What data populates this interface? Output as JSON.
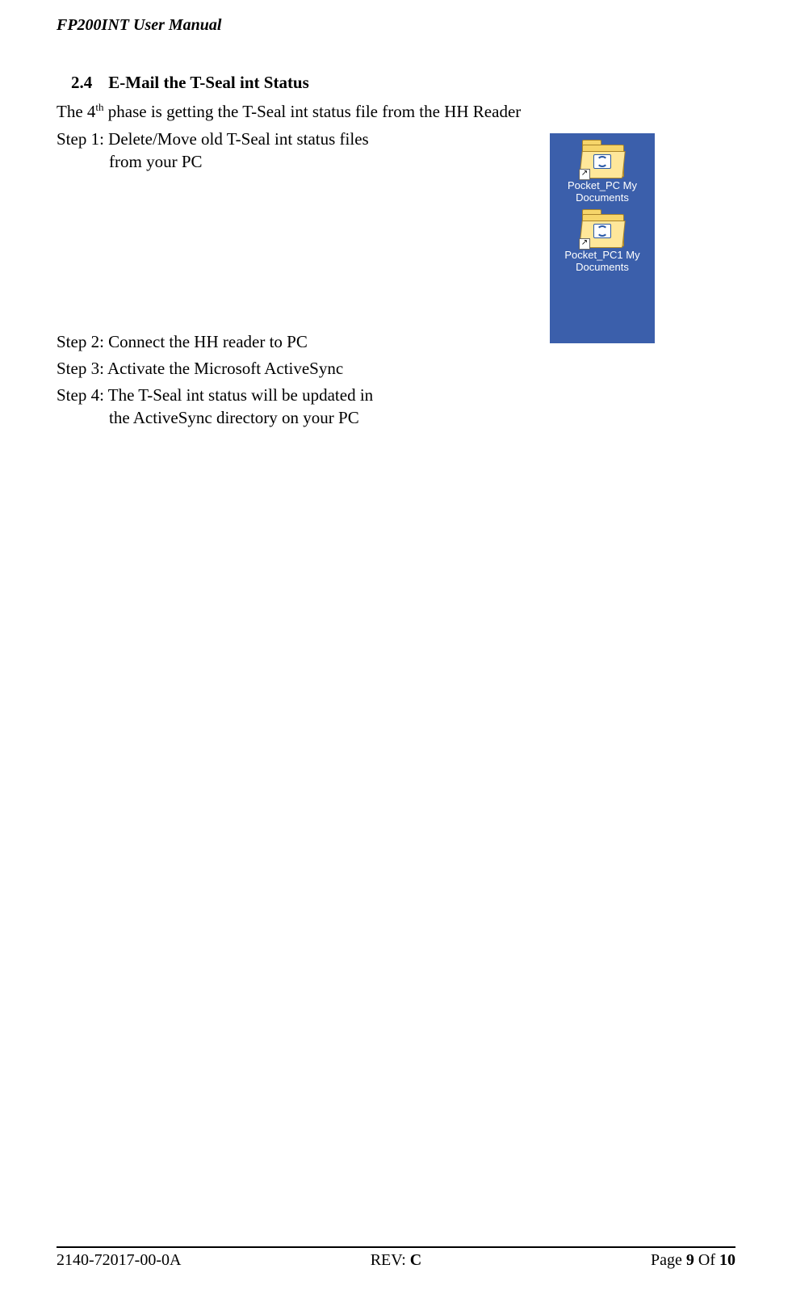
{
  "header": {
    "title": "FP200INT User Manual"
  },
  "section": {
    "number": "2.4",
    "title": "E-Mail the T-Seal int Status"
  },
  "intro": {
    "prefix": "The 4",
    "sup": "th",
    "rest": " phase is getting the T-Seal int status file from the HH Reader"
  },
  "steps": {
    "s1_line1": "Step 1: Delete/Move old T-Seal int status files",
    "s1_line2": "from your PC",
    "s2": "Step 2:  Connect the HH reader to PC",
    "s3": "Step 3: Activate the Microsoft ActiveSync",
    "s4_line1": "Step 4: The T-Seal int status will be updated in",
    "s4_line2": "the ActiveSync directory on your PC"
  },
  "desktop_icons": {
    "icon1_label": "Pocket_PC My Documents",
    "icon2_label": "Pocket_PC1 My Documents",
    "shortcut_glyph": "↗"
  },
  "footer": {
    "doc_number": "2140-72017-00-0A",
    "rev_label": "REV: ",
    "rev_value": "C",
    "page_label": "Page ",
    "page_current": "9",
    "page_of": " Of  ",
    "page_total": "10"
  }
}
